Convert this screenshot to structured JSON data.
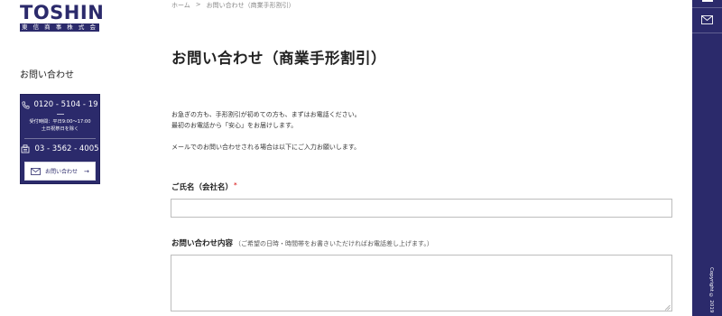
{
  "brand": {
    "logo_text": "TOSHIN",
    "logo_subtext": "東 信 商 事 株 式 会 社"
  },
  "sidebar": {
    "title": "お問い合わせ",
    "phone": "0120 - 5104 - 19",
    "hours_line1": "受付時間：平日9:00～17:00",
    "hours_line2": "土日祝祭日を除く",
    "fax": "03 - 3562 - 4005",
    "mail_button_label": "お問い合わせ"
  },
  "breadcrumb": {
    "home": "ホーム",
    "separator": ">",
    "current": "お問い合わせ（商業手形割引）"
  },
  "page": {
    "title": "お問い合わせ（商業手形割引）",
    "intro_line1": "お急ぎの方も、手形割引が初めての方も、まずはお電話ください。",
    "intro_line2": "最初のお電話から「安心」をお届けします。",
    "intro_line3": "メールでのお問い合わせされる場合は以下にご入力お願いします。"
  },
  "form": {
    "name_label": "ご氏名（会社名）",
    "required_mark": "*",
    "inquiry_label": "お問い合わせ内容",
    "inquiry_note": "（ご希望の日時・時間帯をお書きいただければお電話差し上げます。）"
  },
  "rail": {
    "copyright": "Copyright © 2019"
  },
  "colors": {
    "brand_navy": "#2b2a6b",
    "required_red": "#dd3333"
  }
}
